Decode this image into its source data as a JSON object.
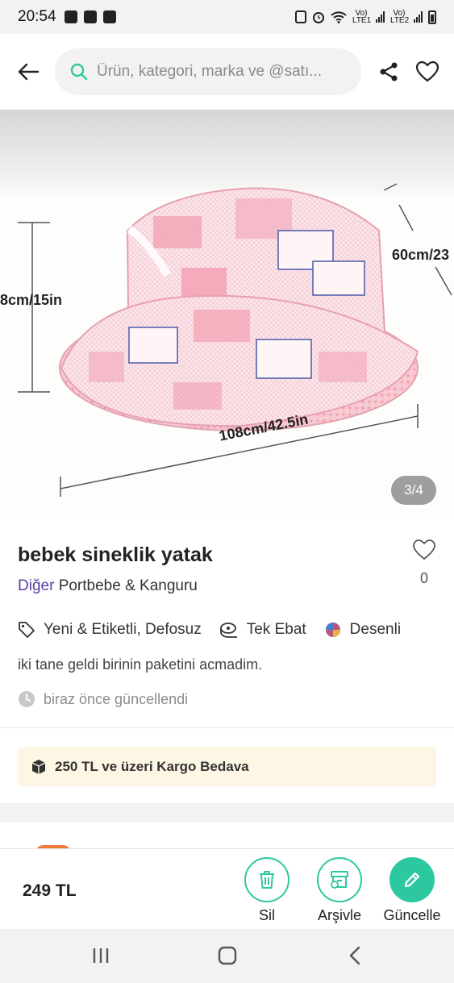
{
  "status_bar": {
    "time": "20:54",
    "network_1": "Vo) LTE1",
    "network_2": "Vo) LTE2"
  },
  "header": {
    "search_placeholder": "Ürün, kategori, marka ve @satı...",
    "icons": [
      "back-arrow-icon",
      "search-icon",
      "share-icon",
      "heart-icon"
    ]
  },
  "gallery": {
    "counter": "3/4",
    "dimension_labels": {
      "height": "8cm/15in",
      "depth": "60cm/23",
      "length": "108cm/42.5in"
    }
  },
  "product": {
    "title": "bebek sineklik yatak",
    "favorite_count": "0",
    "category": "Diğer",
    "brand": "Portbebe & Kanguru",
    "attributes": [
      {
        "icon": "tag-icon",
        "label": "Yeni & Etiketli, Defosuz"
      },
      {
        "icon": "tape-measure-icon",
        "label": "Tek Ebat"
      },
      {
        "icon": "color-ball-icon",
        "label": "Desenli"
      }
    ],
    "description": "iki tane geldi birinin paketini acmadim.",
    "updated": "biraz önce güncellendi"
  },
  "shipping_banner": "250 TL ve üzeri Kargo Bedava",
  "action_bar": {
    "price": "249 TL",
    "actions": [
      {
        "icon": "trash-icon",
        "label": "Sil"
      },
      {
        "icon": "archive-icon",
        "label": "Arşivle"
      },
      {
        "icon": "pencil-icon",
        "label": "Güncelle"
      }
    ]
  },
  "colors": {
    "accent": "#2dc8a0",
    "category_link": "#5a3ea0",
    "shipping_bg": "#fdf6e4",
    "bed_pink": "#f3a9b8"
  }
}
